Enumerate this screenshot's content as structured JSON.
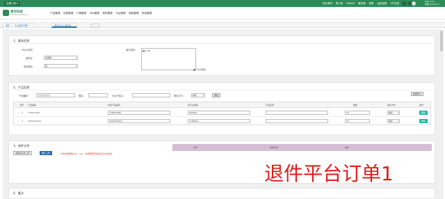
{
  "topbar": {
    "quick_button": "后期订单 ▾",
    "links": [
      "待办事项",
      "帮订单",
      "FBASN",
      "服务通",
      "退单",
      "运费结算",
      "API文档"
    ],
    "user_greeting": "Welcome,",
    "user_name": "管理 [admin] ▾"
  },
  "brand": {
    "name": "易仓科技",
    "tagline": "ECCANG TECHNOLOGY"
  },
  "nav": [
    "产品管理",
    "仓配管理",
    "订单管理",
    "FBA管理",
    "退货管理",
    "平台管理",
    "费用管理",
    "系统管理"
  ],
  "tabs": [
    {
      "label": "首页"
    },
    {
      "label": "平台退件列表"
    },
    {
      "label": "退件平台订单[新]"
    }
  ],
  "section1": {
    "title": "1、基本信息",
    "fba_label": "FBA订单号：",
    "warehouse_label": "退货仓：",
    "warehouse_value": "请选择",
    "reship_label": "是否换标：",
    "reship_value": "否",
    "remark_label": "退件说明：",
    "textarea_value": "a:28",
    "checkbox_label": "不允许编辑"
  },
  "section2": {
    "title": "2、产品信息",
    "sku_label": "产品编码：",
    "sku_placeholder": "支持模糊搜索",
    "qty_label": "数量：",
    "platform_label": "平台产品名：",
    "return_label": "换标方式：",
    "return_value": "换标",
    "add_button": "添加",
    "import_button": "批量导入",
    "columns": [
      "序号",
      "产品编码",
      "仓库产品编码",
      "新平台编码",
      "产品名称",
      "数量",
      "换标方式",
      "操作"
    ],
    "rows": [
      {
        "index": "1",
        "sku": "776411965",
        "warehouse_sku": "776411965",
        "platform_sku": "064321",
        "qty": "10",
        "method": "换标",
        "action": "删除"
      },
      {
        "index": "2",
        "sku": "65632792ad",
        "warehouse_sku": "45632792ad",
        "platform_sku": "7766431",
        "qty": "23",
        "method": "换标",
        "action": "删除"
      }
    ]
  },
  "section3": {
    "title": "3、退件文件",
    "choose_button": "选择多文件上传",
    "upload_button": "确认上传",
    "file_columns": [
      "文件",
      "创建时间",
      "操作"
    ],
    "notice": "文件类型限制(pdf、xls)，请按照规范提供对应文件格式"
  },
  "section4": {
    "title": "4、备注"
  },
  "watermark_title": "退件平台订单1",
  "colors": {
    "topbar": "#2c8c57",
    "accent": "#2b6cb0",
    "action": "#1fb89a",
    "file_header": "#d4bed5",
    "title_red": "#e41b1b"
  }
}
